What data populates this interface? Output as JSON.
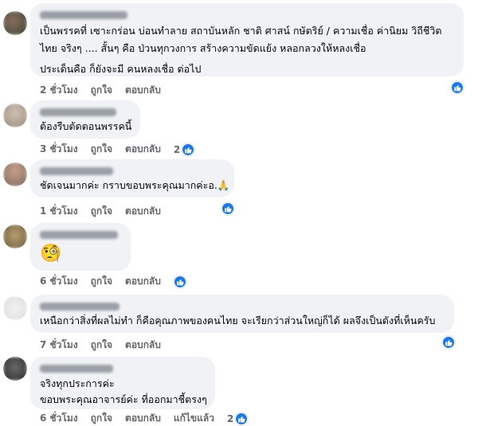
{
  "comments": [
    {
      "avatar_colors": [
        "#3a4a3a",
        "#8a6a5a"
      ],
      "lines": [
        "เป็นพรรคที่ เซาะกร่อน บ่อนทำลาย สถาบันหลัก ชาติ ศาสน์ กษัตริย์ / ความเชื่อ ค่านิยม วิถีชีวิต",
        "ไทย จริงๆ .... สั้นๆ คือ ป่วนทุกวงการ สร้างความขัดแย้ง หลอกลวงให้หลงเชื่อ",
        "ประเด็นคือ ก็ยังจะมี คนหลงเชื่อ ต่อไป"
      ],
      "time": "2 ชั่วโมง",
      "like": "ถูกใจ",
      "reply": "ตอบกลับ",
      "reactions": ""
    },
    {
      "avatar_colors": [
        "#9a8a7a",
        "#cfc3b5"
      ],
      "lines": [
        "ต้องรีบตัดตอนพรรคนี้"
      ],
      "time": "3 ชั่วโมง",
      "like": "ถูกใจ",
      "reply": "ตอบกลับ",
      "reactions": "2"
    },
    {
      "avatar_colors": [
        "#c9a08a",
        "#7a6a60"
      ],
      "lines": [
        "ชัดเจนมากค่ะ กราบขอบพระคุณมากค่ะอ.🙏"
      ],
      "time": "1 ชั่วโมง",
      "like": "ถูกใจ",
      "reply": "ตอบกลับ",
      "reactions": ""
    },
    {
      "avatar_colors": [
        "#6a5a3a",
        "#b8a070"
      ],
      "lines": [
        "🧐"
      ],
      "time": "6 ชั่วโมง",
      "like": "ถูกใจ",
      "reply": "ตอบกลับ",
      "reactions": ""
    },
    {
      "avatar_colors": [
        "#dcdcdc",
        "#f2f2f2"
      ],
      "lines": [
        "เหนือกว่าสิ่งที่ผลไม่ทำ ก็คือคุณภาพของคนไทย จะเรียกว่าส่วนใหญ่ก็ได้ ผลจึงเป็นดังที่เห็นครับ"
      ],
      "time": "7 ชั่วโมง",
      "like": "ถูกใจ",
      "reply": "ตอบกลับ",
      "reactions": ""
    },
    {
      "avatar_colors": [
        "#2a2a2a",
        "#6a6a6a"
      ],
      "lines": [
        "จริงทุกประการค่ะ",
        "ขอบพระคุณอาจารย์ค่ะ ที่ออกมาชี้ตรงๆ"
      ],
      "time": "6 ชั่วโมง",
      "like": "ถูกใจ",
      "reply": "ตอบกลับ",
      "edited": "แก้ไขแล้ว",
      "reactions": "2"
    }
  ],
  "icons": {
    "like_reaction": "thumbs-up-icon",
    "accent": "#1877f2"
  }
}
